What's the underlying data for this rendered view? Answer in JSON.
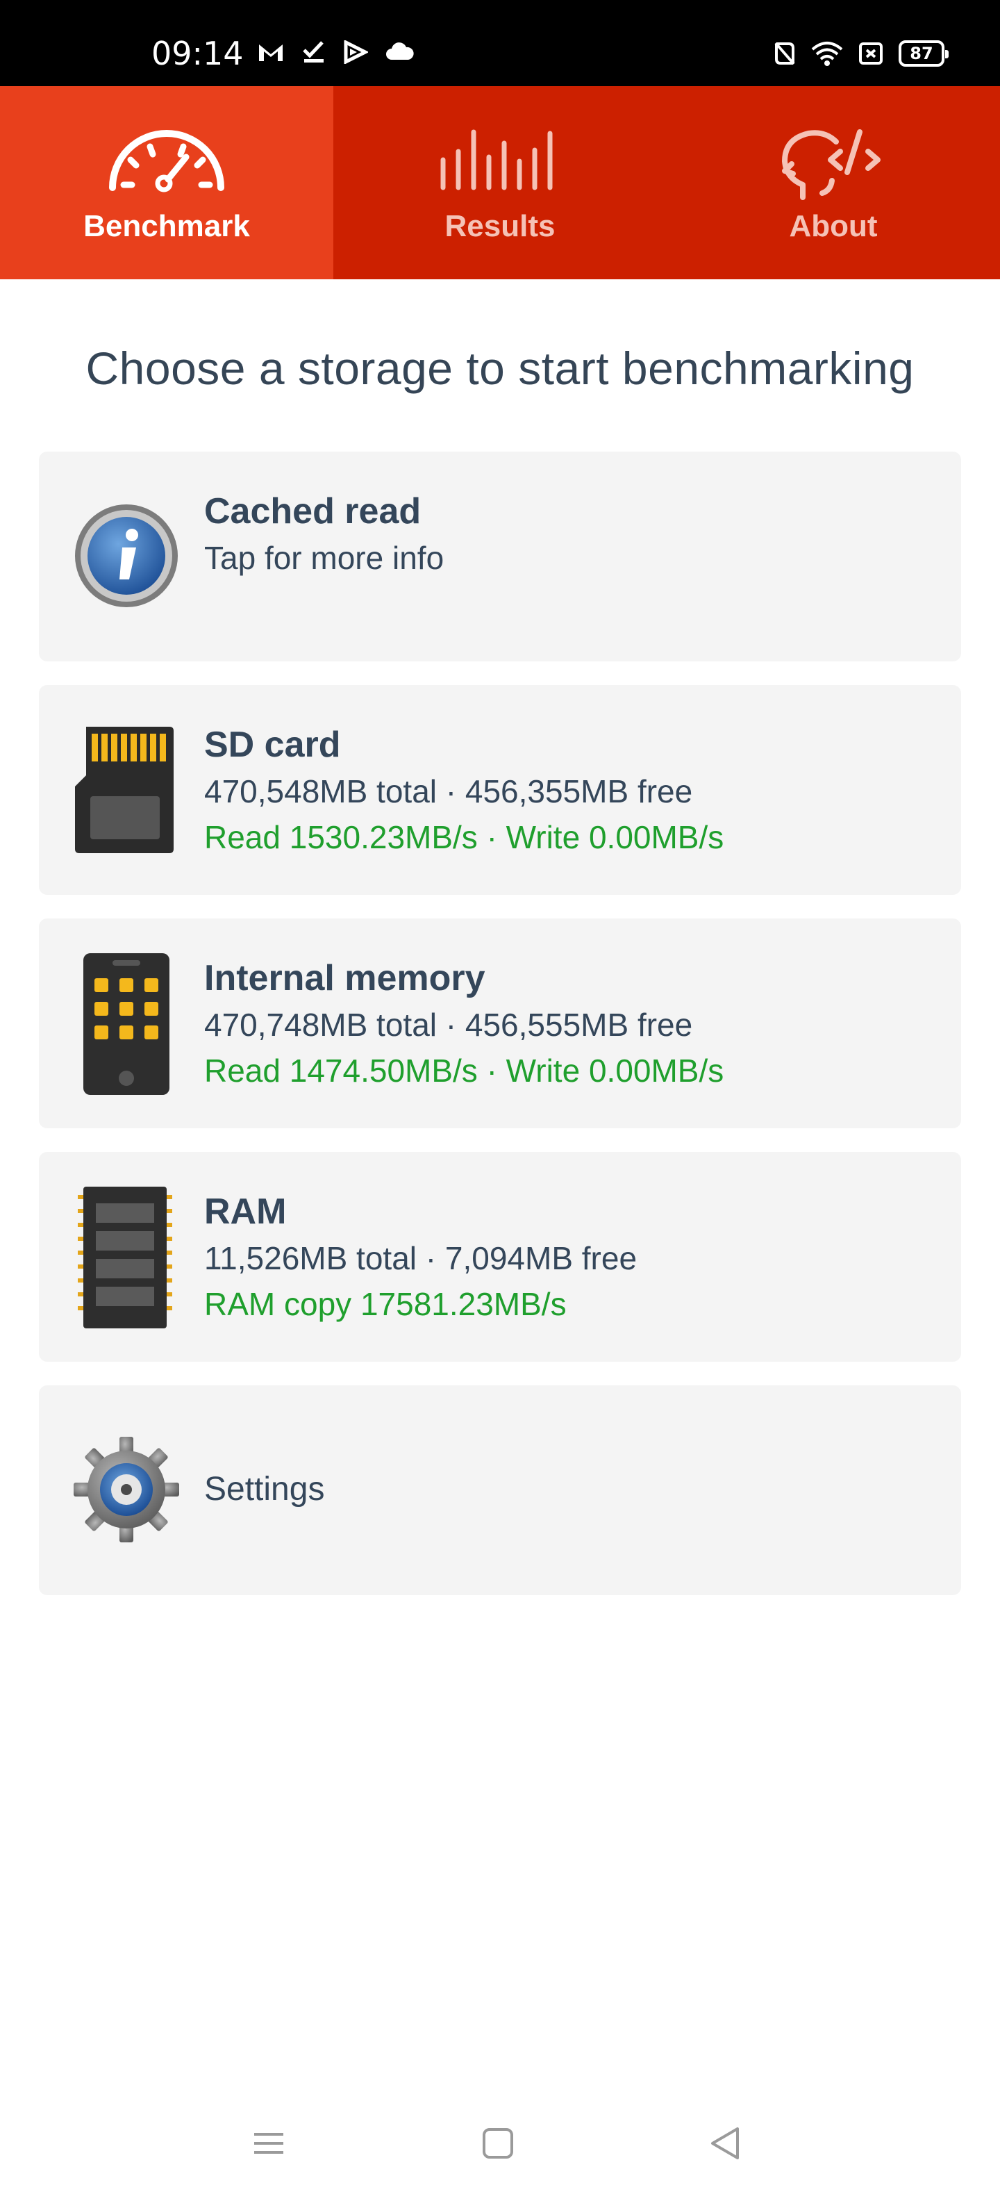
{
  "status_bar": {
    "time": "09:14",
    "battery": "87",
    "left_icons": [
      "gmail-icon",
      "checkmark-icon",
      "play-icon",
      "cloud-icon"
    ],
    "right_icons": [
      "nfc-icon",
      "wifi-icon",
      "screen-icon",
      "battery-icon"
    ]
  },
  "tabs": [
    {
      "label": "Benchmark",
      "icon": "speedometer-icon",
      "active": true
    },
    {
      "label": "Results",
      "icon": "bars-icon",
      "active": false
    },
    {
      "label": "About",
      "icon": "head-code-icon",
      "active": false
    }
  ],
  "page_title": "Choose a storage to start benchmarking",
  "cards": {
    "cached_read": {
      "title": "Cached read",
      "subtitle": "Tap for more info",
      "icon": "info-icon"
    },
    "sd_card": {
      "title": "SD card",
      "capacity": "470,548MB total · 456,355MB free",
      "speed": "Read 1530.23MB/s · Write 0.00MB/s",
      "icon": "sd-card-icon"
    },
    "internal_memory": {
      "title": "Internal memory",
      "capacity": "470,748MB total · 456,555MB free",
      "speed": "Read 1474.50MB/s · Write 0.00MB/s",
      "icon": "phone-icon"
    },
    "ram": {
      "title": "RAM",
      "capacity": "11,526MB total · 7,094MB free",
      "speed": "RAM copy 17581.23MB/s",
      "icon": "ram-chip-icon"
    },
    "settings": {
      "label": "Settings",
      "icon": "gear-icon"
    }
  },
  "colors": {
    "tab_bar": "#cc2000",
    "tab_active": "#e8401c",
    "speed_text": "#1f9f2d",
    "title_text": "#34465a",
    "card_bg": "#f4f4f4"
  },
  "nav_bar": {
    "buttons": [
      "menu-icon",
      "home-icon",
      "back-icon"
    ]
  }
}
